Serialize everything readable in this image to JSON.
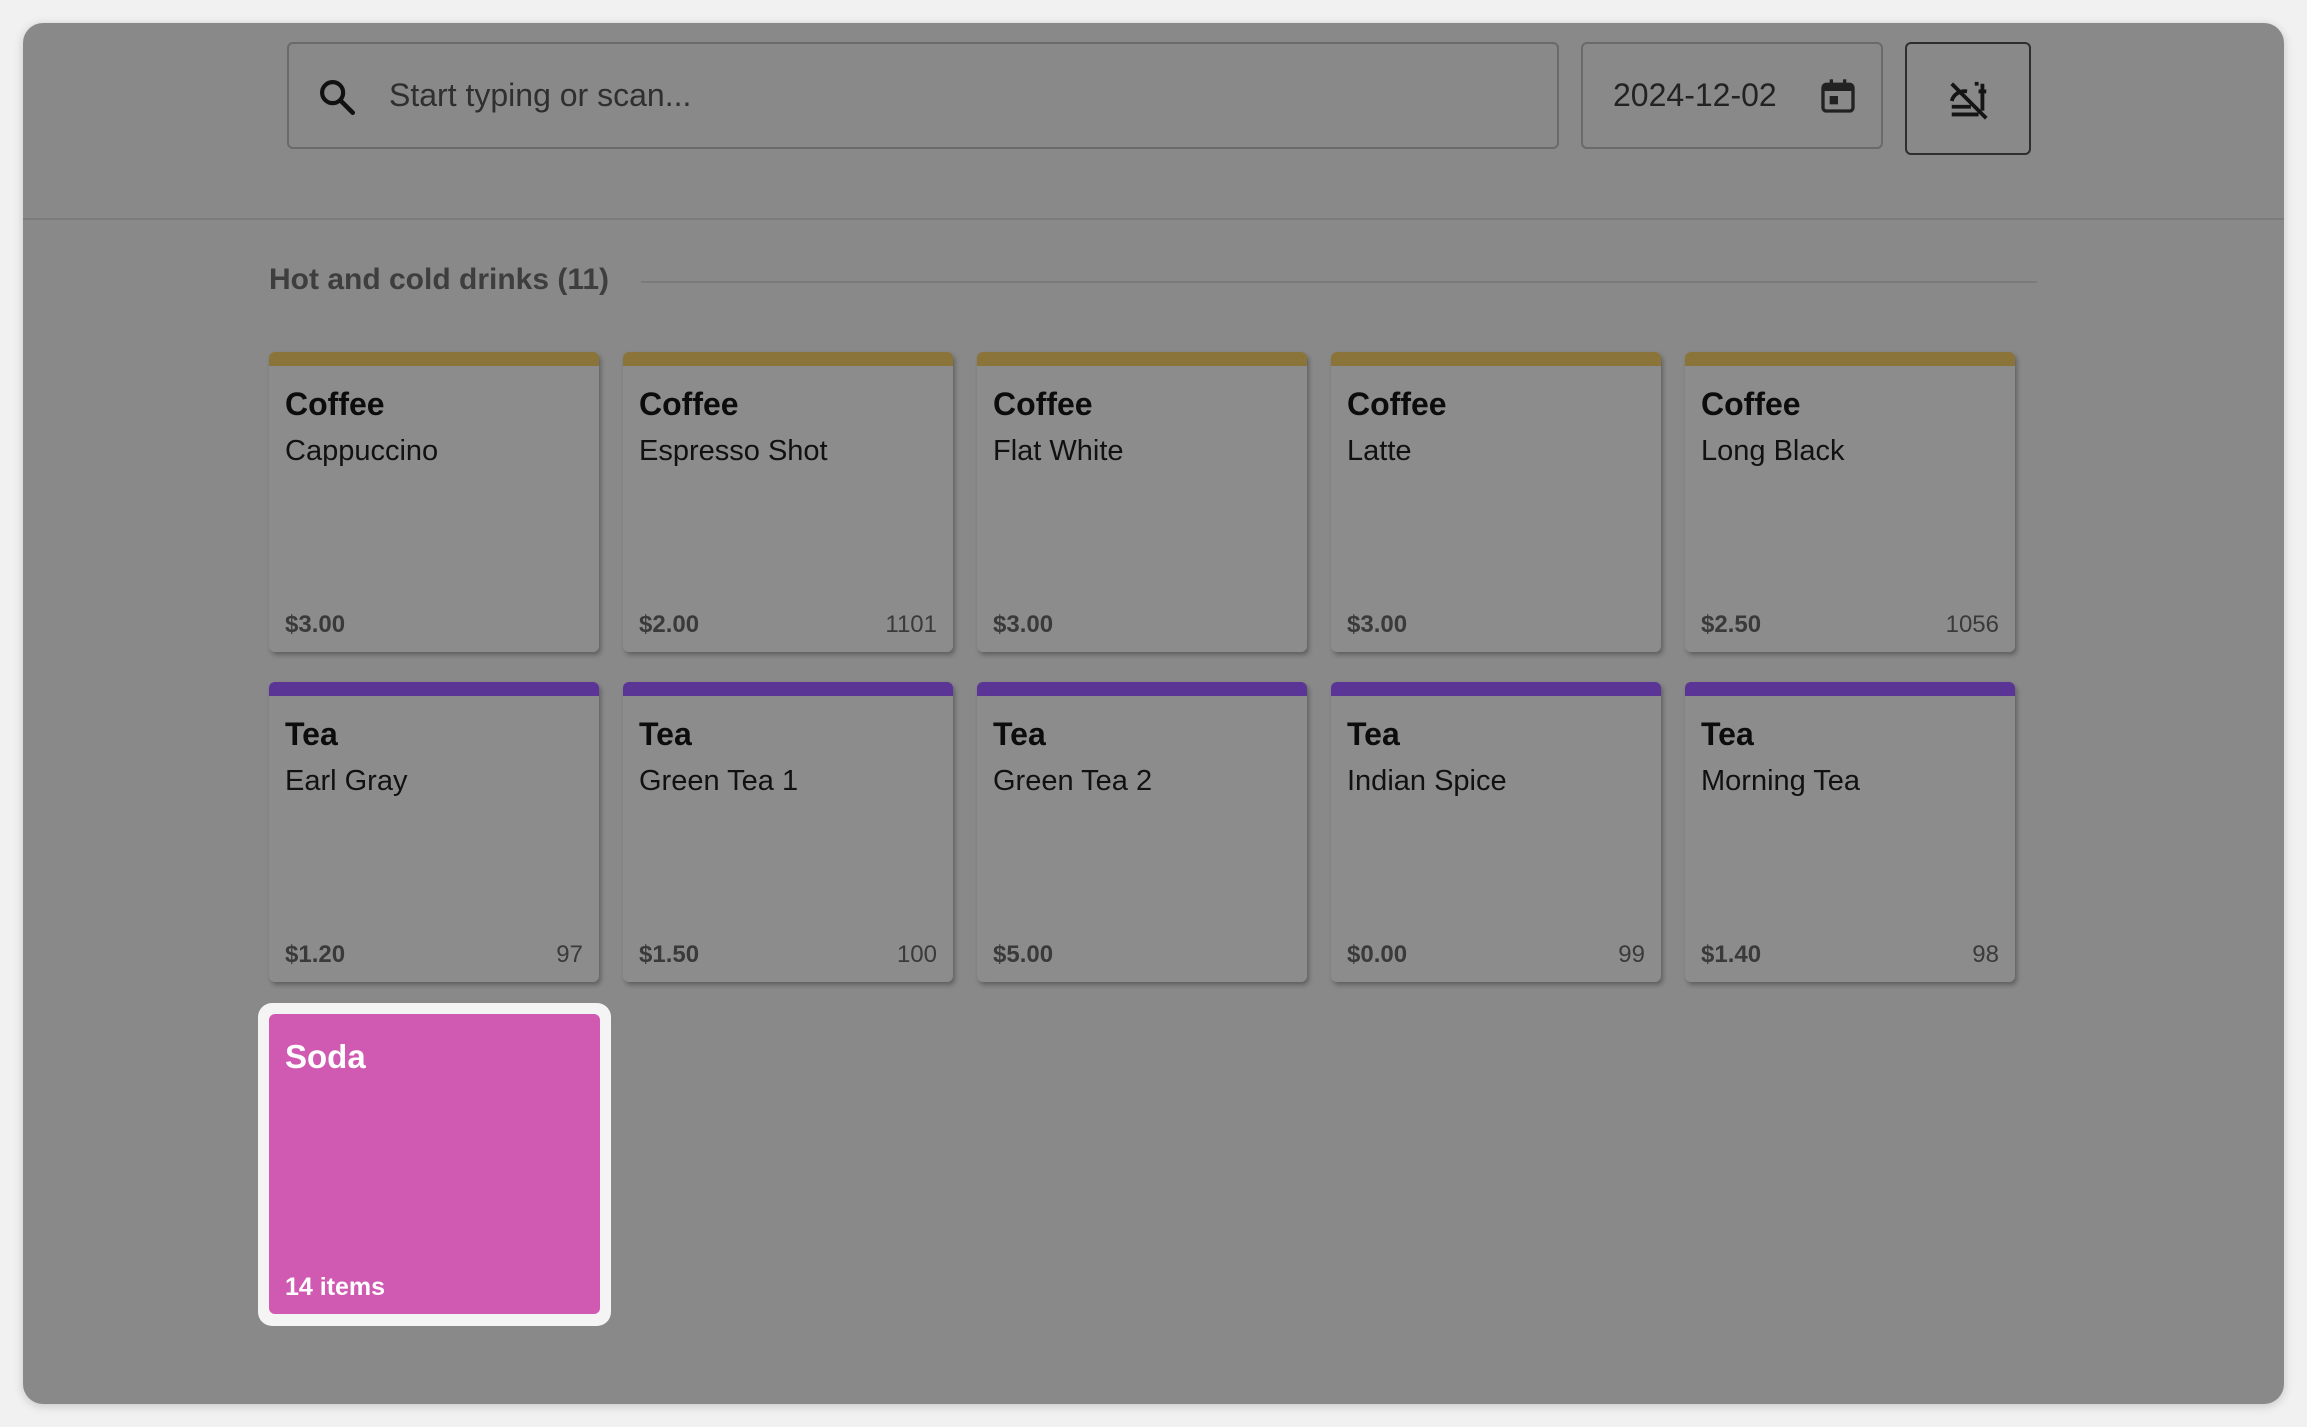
{
  "search": {
    "placeholder": "Start typing or scan...",
    "value": ""
  },
  "date_filter": {
    "value": "2024-12-02"
  },
  "icons": {
    "search": "search-icon",
    "calendar": "calendar-icon",
    "filter_toggle": "no-meals-icon"
  },
  "section": {
    "title": "Hot and cold drinks (11)"
  },
  "colors": {
    "coffee_accent": "#8b7439",
    "tea_accent": "#5a3595",
    "soda_accent": "#d05ab1"
  },
  "products": [
    {
      "category": "Coffee",
      "name": "Cappuccino",
      "price": "$3.00",
      "stock": ""
    },
    {
      "category": "Coffee",
      "name": "Espresso Shot",
      "price": "$2.00",
      "stock": "1101"
    },
    {
      "category": "Coffee",
      "name": "Flat White",
      "price": "$3.00",
      "stock": ""
    },
    {
      "category": "Coffee",
      "name": "Latte",
      "price": "$3.00",
      "stock": ""
    },
    {
      "category": "Coffee",
      "name": "Long Black",
      "price": "$2.50",
      "stock": "1056"
    },
    {
      "category": "Tea",
      "name": "Earl Gray",
      "price": "$1.20",
      "stock": "97"
    },
    {
      "category": "Tea",
      "name": "Green Tea 1",
      "price": "$1.50",
      "stock": "100"
    },
    {
      "category": "Tea",
      "name": "Green Tea 2",
      "price": "$5.00",
      "stock": ""
    },
    {
      "category": "Tea",
      "name": "Indian Spice",
      "price": "$0.00",
      "stock": "99"
    },
    {
      "category": "Tea",
      "name": "Morning Tea",
      "price": "$1.40",
      "stock": "98"
    }
  ],
  "subcategory": {
    "name": "Soda",
    "count": "14 items"
  }
}
